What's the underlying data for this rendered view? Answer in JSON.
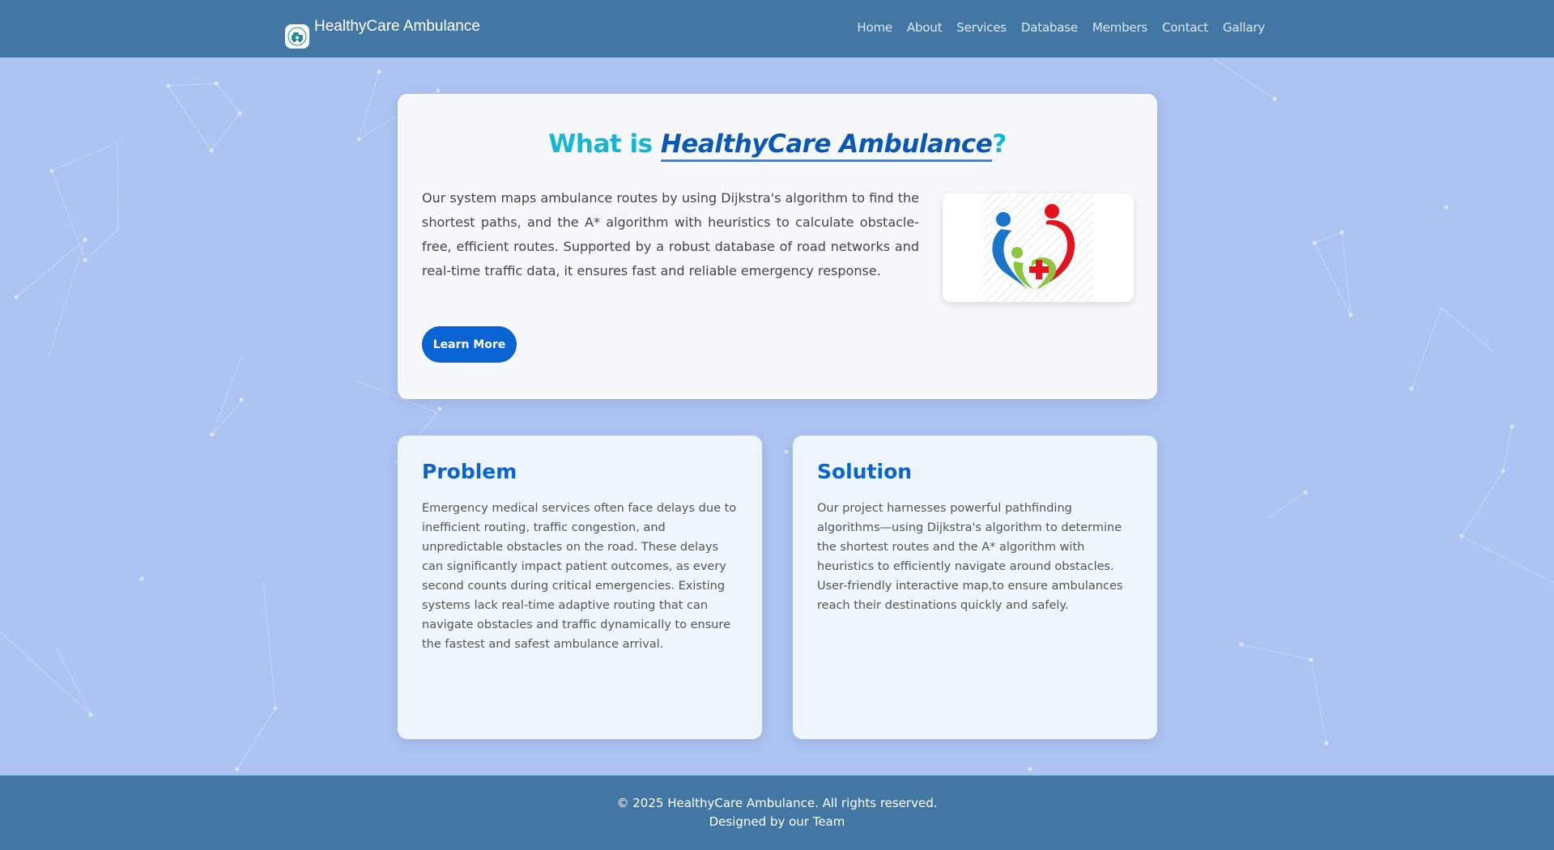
{
  "brand": {
    "name": "HealthyCare Ambulance",
    "logo_icon": "ambulance-logo-icon"
  },
  "nav": {
    "items": [
      "Home",
      "About",
      "Services",
      "Database",
      "Members",
      "Contact",
      "Gallary"
    ]
  },
  "hero": {
    "title_prefix": "What is ",
    "title_highlight": "HealthyCare Ambulance",
    "title_suffix": "?",
    "text": "Our system maps ambulance routes by using Dijkstra's algorithm to find the shortest paths, and the A* algorithm with heuristics to calculate obstacle-free, efficient routes. Supported by a robust database of road networks and real-time traffic data, it ensures fast and reliable emergency response.",
    "image_icon": "family-heart-medical-icon",
    "button_label": "Learn More"
  },
  "problem": {
    "title": "Problem",
    "text": "Emergency medical services often face delays due to inefficient routing, traffic congestion, and unpredictable obstacles on the road. These delays can significantly impact patient outcomes, as every second counts during critical emergencies. Existing systems lack real-time adaptive routing that can navigate obstacles and traffic dynamically to ensure the fastest and safest ambulance arrival."
  },
  "solution": {
    "title": "Solution",
    "text": "Our project harnesses powerful pathfinding algorithms—using Dijkstra's algorithm to determine the shortest routes and the A* algorithm with heuristics to efficiently navigate around obstacles. User-friendly interactive map,to ensure ambulances reach their destinations quickly and safely."
  },
  "footer": {
    "copyright": "© 2025 HealthyCare Ambulance. All rights reserved.",
    "credit": "Designed by our Team"
  },
  "colors": {
    "nav_bg": "#4277a3",
    "page_bg": "#adc3f2",
    "accent": "#0a63d3",
    "title_cyan": "#14b6d6"
  }
}
